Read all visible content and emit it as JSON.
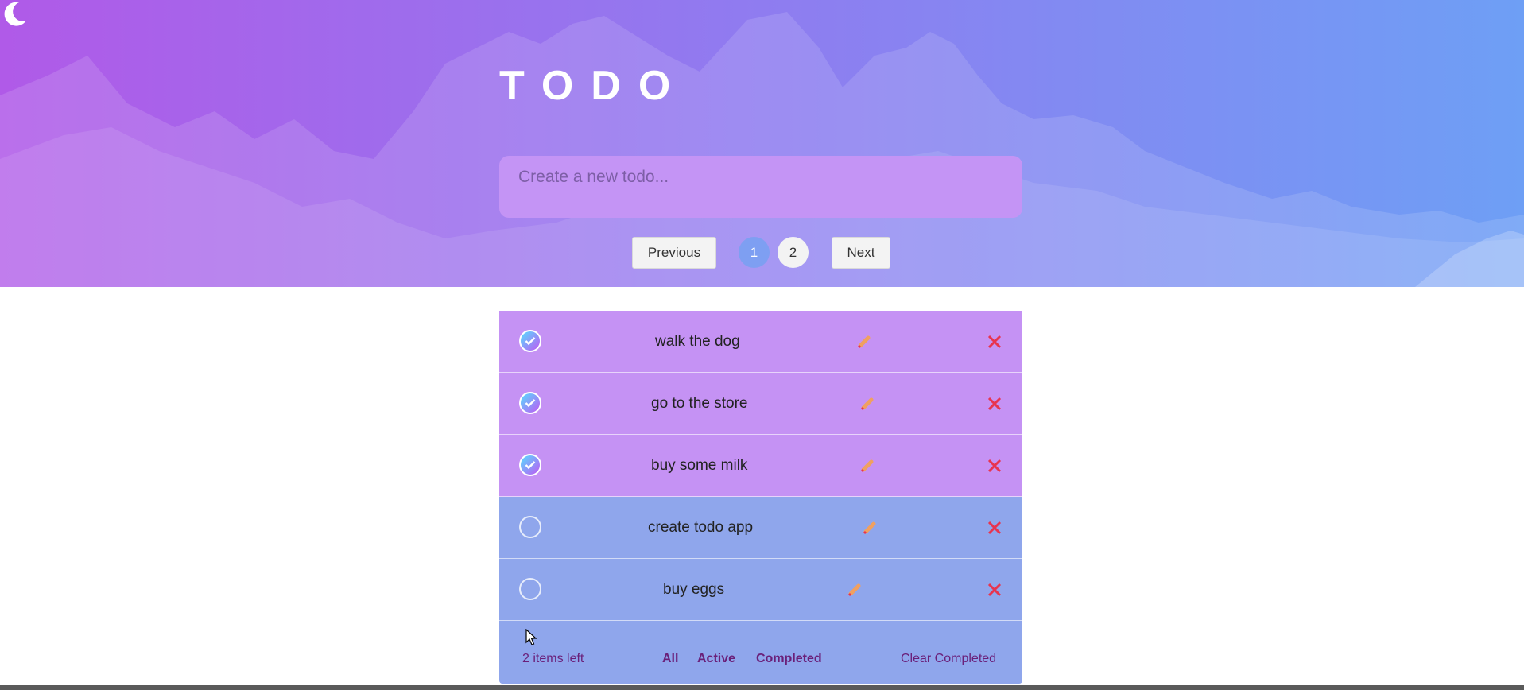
{
  "header": {
    "title": "TODO",
    "theme_toggle_icon": "moon-icon"
  },
  "new_todo": {
    "placeholder": "Create a new todo..."
  },
  "pagination": {
    "previous_label": "Previous",
    "next_label": "Next",
    "pages": [
      "1",
      "2"
    ],
    "current_page": "1"
  },
  "todos": [
    {
      "text": "walk the dog",
      "completed": true
    },
    {
      "text": "go to the store",
      "completed": true
    },
    {
      "text": "buy some milk",
      "completed": true
    },
    {
      "text": "create todo app",
      "completed": false
    },
    {
      "text": "buy eggs",
      "completed": false
    }
  ],
  "footer": {
    "items_left": "2 items left",
    "filters": [
      "All",
      "Active",
      "Completed"
    ],
    "clear_label": "Clear Completed"
  },
  "colors": {
    "completed_row": "#c592f4",
    "active_row": "#8fa6ec",
    "delete": "#e8344f",
    "filter_text": "#6a1f79"
  }
}
